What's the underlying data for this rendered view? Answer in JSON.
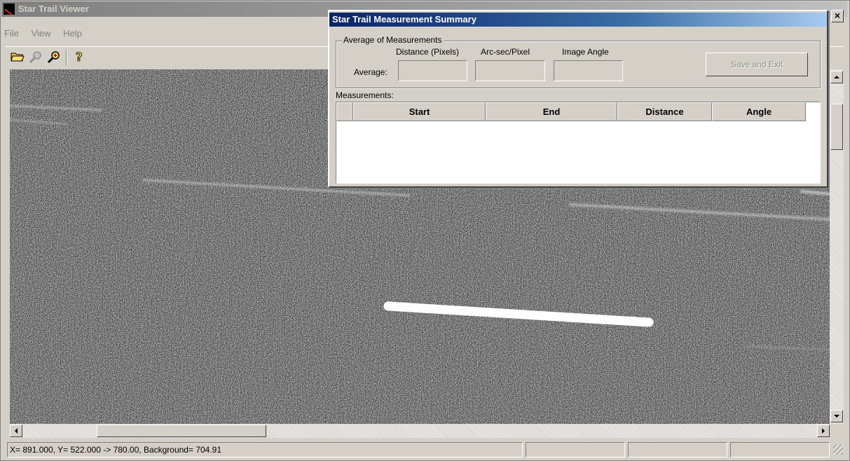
{
  "main_window": {
    "title": "Star Trail Viewer",
    "close_glyph": "×"
  },
  "menu": [
    "File",
    "View",
    "Help"
  ],
  "toolbar": {
    "icons": [
      "open-folder-icon",
      "zoom-out-icon",
      "zoom-in-icon",
      "help-icon"
    ]
  },
  "status_bar": {
    "readout": "X= 891.000, Y= 522.000 ->  780.00,  Background=  704.91",
    "pane2": "",
    "pane3": "",
    "pane4": ""
  },
  "dialog": {
    "title": "Star Trail Measurement Summary",
    "group_label": "Average of Measurements",
    "row_label": "Average:",
    "columns": {
      "distance": "Distance (Pixels)",
      "arcsec": "Arc-sec/Pixel",
      "angle": "Image Angle"
    },
    "values": {
      "distance": "",
      "arcsec": "",
      "angle": ""
    },
    "save_button": "Save and Exit",
    "measurements_label": "Measurements:",
    "table_headers": [
      "",
      "Start",
      "End",
      "Distance",
      "Angle"
    ],
    "rows": []
  },
  "colors": {
    "dialog_title_start": "#0a246a",
    "dialog_title_end": "#a6caf0",
    "inactive_title": "#808080",
    "window_face": "#d4d0c8"
  }
}
